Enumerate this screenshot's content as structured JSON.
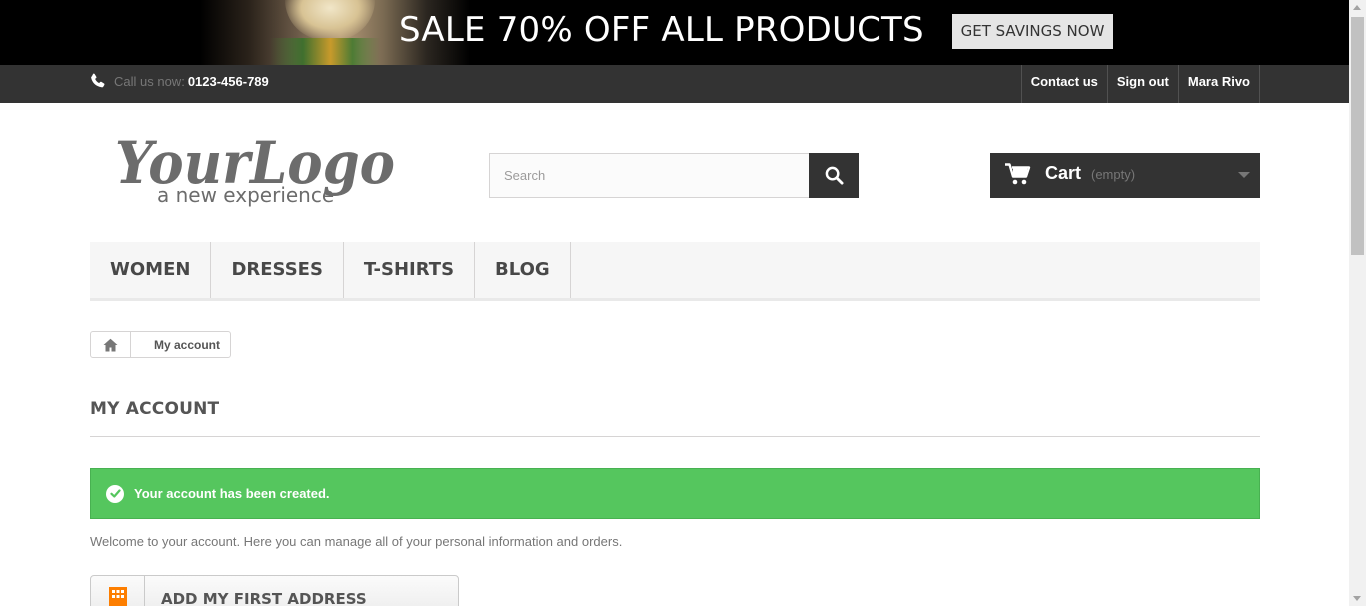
{
  "banner": {
    "headline": "SALE 70% OFF ALL PRODUCTS",
    "cta_label": "GET SAVINGS NOW"
  },
  "topbar": {
    "phone_prefix": "Call us now:",
    "phone_number": "0123-456-789",
    "links": [
      "Contact us",
      "Sign out",
      "Mara Rivo"
    ]
  },
  "header": {
    "logo_text": "YourLogo",
    "logo_tagline": "a new experience",
    "search_placeholder": "Search",
    "cart_label": "Cart",
    "cart_status": "(empty)"
  },
  "menu": {
    "items": [
      "WOMEN",
      "DRESSES",
      "T-SHIRTS",
      "BLOG"
    ]
  },
  "breadcrumb": {
    "current": "My account"
  },
  "main": {
    "page_title": "MY ACCOUNT",
    "alert_message": "Your account has been created.",
    "welcome_text": "Welcome to your account. Here you can manage all of your personal information and orders.",
    "address_button_label": "ADD MY FIRST ADDRESS"
  },
  "colors": {
    "success": "#55c65e",
    "dark": "#333333",
    "address_icon": "#fd7e00"
  },
  "icons": [
    "phone-icon",
    "search-icon",
    "cart-icon",
    "home-icon",
    "check-circle-icon",
    "building-icon"
  ]
}
